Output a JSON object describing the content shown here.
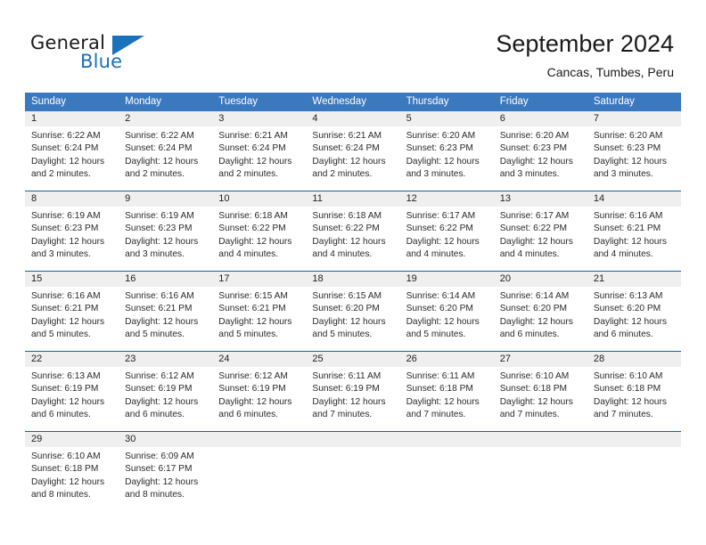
{
  "brand": {
    "name_part1": "General",
    "name_part2": "Blue",
    "logo_icon": "triangle-logo-icon",
    "accent_color": "#1c72ba"
  },
  "header": {
    "title": "September 2024",
    "location": "Cancas, Tumbes, Peru"
  },
  "calendar": {
    "header_bg": "#3b79bf",
    "date_band_bg": "#efefef",
    "separator_color": "#1c5fa8",
    "weekdays": [
      "Sunday",
      "Monday",
      "Tuesday",
      "Wednesday",
      "Thursday",
      "Friday",
      "Saturday"
    ],
    "weeks": [
      [
        {
          "day": "1",
          "sunrise": "Sunrise: 6:22 AM",
          "sunset": "Sunset: 6:24 PM",
          "daylight": "Daylight: 12 hours and 2 minutes."
        },
        {
          "day": "2",
          "sunrise": "Sunrise: 6:22 AM",
          "sunset": "Sunset: 6:24 PM",
          "daylight": "Daylight: 12 hours and 2 minutes."
        },
        {
          "day": "3",
          "sunrise": "Sunrise: 6:21 AM",
          "sunset": "Sunset: 6:24 PM",
          "daylight": "Daylight: 12 hours and 2 minutes."
        },
        {
          "day": "4",
          "sunrise": "Sunrise: 6:21 AM",
          "sunset": "Sunset: 6:24 PM",
          "daylight": "Daylight: 12 hours and 2 minutes."
        },
        {
          "day": "5",
          "sunrise": "Sunrise: 6:20 AM",
          "sunset": "Sunset: 6:23 PM",
          "daylight": "Daylight: 12 hours and 3 minutes."
        },
        {
          "day": "6",
          "sunrise": "Sunrise: 6:20 AM",
          "sunset": "Sunset: 6:23 PM",
          "daylight": "Daylight: 12 hours and 3 minutes."
        },
        {
          "day": "7",
          "sunrise": "Sunrise: 6:20 AM",
          "sunset": "Sunset: 6:23 PM",
          "daylight": "Daylight: 12 hours and 3 minutes."
        }
      ],
      [
        {
          "day": "8",
          "sunrise": "Sunrise: 6:19 AM",
          "sunset": "Sunset: 6:23 PM",
          "daylight": "Daylight: 12 hours and 3 minutes."
        },
        {
          "day": "9",
          "sunrise": "Sunrise: 6:19 AM",
          "sunset": "Sunset: 6:23 PM",
          "daylight": "Daylight: 12 hours and 3 minutes."
        },
        {
          "day": "10",
          "sunrise": "Sunrise: 6:18 AM",
          "sunset": "Sunset: 6:22 PM",
          "daylight": "Daylight: 12 hours and 4 minutes."
        },
        {
          "day": "11",
          "sunrise": "Sunrise: 6:18 AM",
          "sunset": "Sunset: 6:22 PM",
          "daylight": "Daylight: 12 hours and 4 minutes."
        },
        {
          "day": "12",
          "sunrise": "Sunrise: 6:17 AM",
          "sunset": "Sunset: 6:22 PM",
          "daylight": "Daylight: 12 hours and 4 minutes."
        },
        {
          "day": "13",
          "sunrise": "Sunrise: 6:17 AM",
          "sunset": "Sunset: 6:22 PM",
          "daylight": "Daylight: 12 hours and 4 minutes."
        },
        {
          "day": "14",
          "sunrise": "Sunrise: 6:16 AM",
          "sunset": "Sunset: 6:21 PM",
          "daylight": "Daylight: 12 hours and 4 minutes."
        }
      ],
      [
        {
          "day": "15",
          "sunrise": "Sunrise: 6:16 AM",
          "sunset": "Sunset: 6:21 PM",
          "daylight": "Daylight: 12 hours and 5 minutes."
        },
        {
          "day": "16",
          "sunrise": "Sunrise: 6:16 AM",
          "sunset": "Sunset: 6:21 PM",
          "daylight": "Daylight: 12 hours and 5 minutes."
        },
        {
          "day": "17",
          "sunrise": "Sunrise: 6:15 AM",
          "sunset": "Sunset: 6:21 PM",
          "daylight": "Daylight: 12 hours and 5 minutes."
        },
        {
          "day": "18",
          "sunrise": "Sunrise: 6:15 AM",
          "sunset": "Sunset: 6:20 PM",
          "daylight": "Daylight: 12 hours and 5 minutes."
        },
        {
          "day": "19",
          "sunrise": "Sunrise: 6:14 AM",
          "sunset": "Sunset: 6:20 PM",
          "daylight": "Daylight: 12 hours and 5 minutes."
        },
        {
          "day": "20",
          "sunrise": "Sunrise: 6:14 AM",
          "sunset": "Sunset: 6:20 PM",
          "daylight": "Daylight: 12 hours and 6 minutes."
        },
        {
          "day": "21",
          "sunrise": "Sunrise: 6:13 AM",
          "sunset": "Sunset: 6:20 PM",
          "daylight": "Daylight: 12 hours and 6 minutes."
        }
      ],
      [
        {
          "day": "22",
          "sunrise": "Sunrise: 6:13 AM",
          "sunset": "Sunset: 6:19 PM",
          "daylight": "Daylight: 12 hours and 6 minutes."
        },
        {
          "day": "23",
          "sunrise": "Sunrise: 6:12 AM",
          "sunset": "Sunset: 6:19 PM",
          "daylight": "Daylight: 12 hours and 6 minutes."
        },
        {
          "day": "24",
          "sunrise": "Sunrise: 6:12 AM",
          "sunset": "Sunset: 6:19 PM",
          "daylight": "Daylight: 12 hours and 6 minutes."
        },
        {
          "day": "25",
          "sunrise": "Sunrise: 6:11 AM",
          "sunset": "Sunset: 6:19 PM",
          "daylight": "Daylight: 12 hours and 7 minutes."
        },
        {
          "day": "26",
          "sunrise": "Sunrise: 6:11 AM",
          "sunset": "Sunset: 6:18 PM",
          "daylight": "Daylight: 12 hours and 7 minutes."
        },
        {
          "day": "27",
          "sunrise": "Sunrise: 6:10 AM",
          "sunset": "Sunset: 6:18 PM",
          "daylight": "Daylight: 12 hours and 7 minutes."
        },
        {
          "day": "28",
          "sunrise": "Sunrise: 6:10 AM",
          "sunset": "Sunset: 6:18 PM",
          "daylight": "Daylight: 12 hours and 7 minutes."
        }
      ],
      [
        {
          "day": "29",
          "sunrise": "Sunrise: 6:10 AM",
          "sunset": "Sunset: 6:18 PM",
          "daylight": "Daylight: 12 hours and 8 minutes."
        },
        {
          "day": "30",
          "sunrise": "Sunrise: 6:09 AM",
          "sunset": "Sunset: 6:17 PM",
          "daylight": "Daylight: 12 hours and 8 minutes."
        },
        {
          "day": "",
          "sunrise": "",
          "sunset": "",
          "daylight": ""
        },
        {
          "day": "",
          "sunrise": "",
          "sunset": "",
          "daylight": ""
        },
        {
          "day": "",
          "sunrise": "",
          "sunset": "",
          "daylight": ""
        },
        {
          "day": "",
          "sunrise": "",
          "sunset": "",
          "daylight": ""
        },
        {
          "day": "",
          "sunrise": "",
          "sunset": "",
          "daylight": ""
        }
      ]
    ]
  }
}
